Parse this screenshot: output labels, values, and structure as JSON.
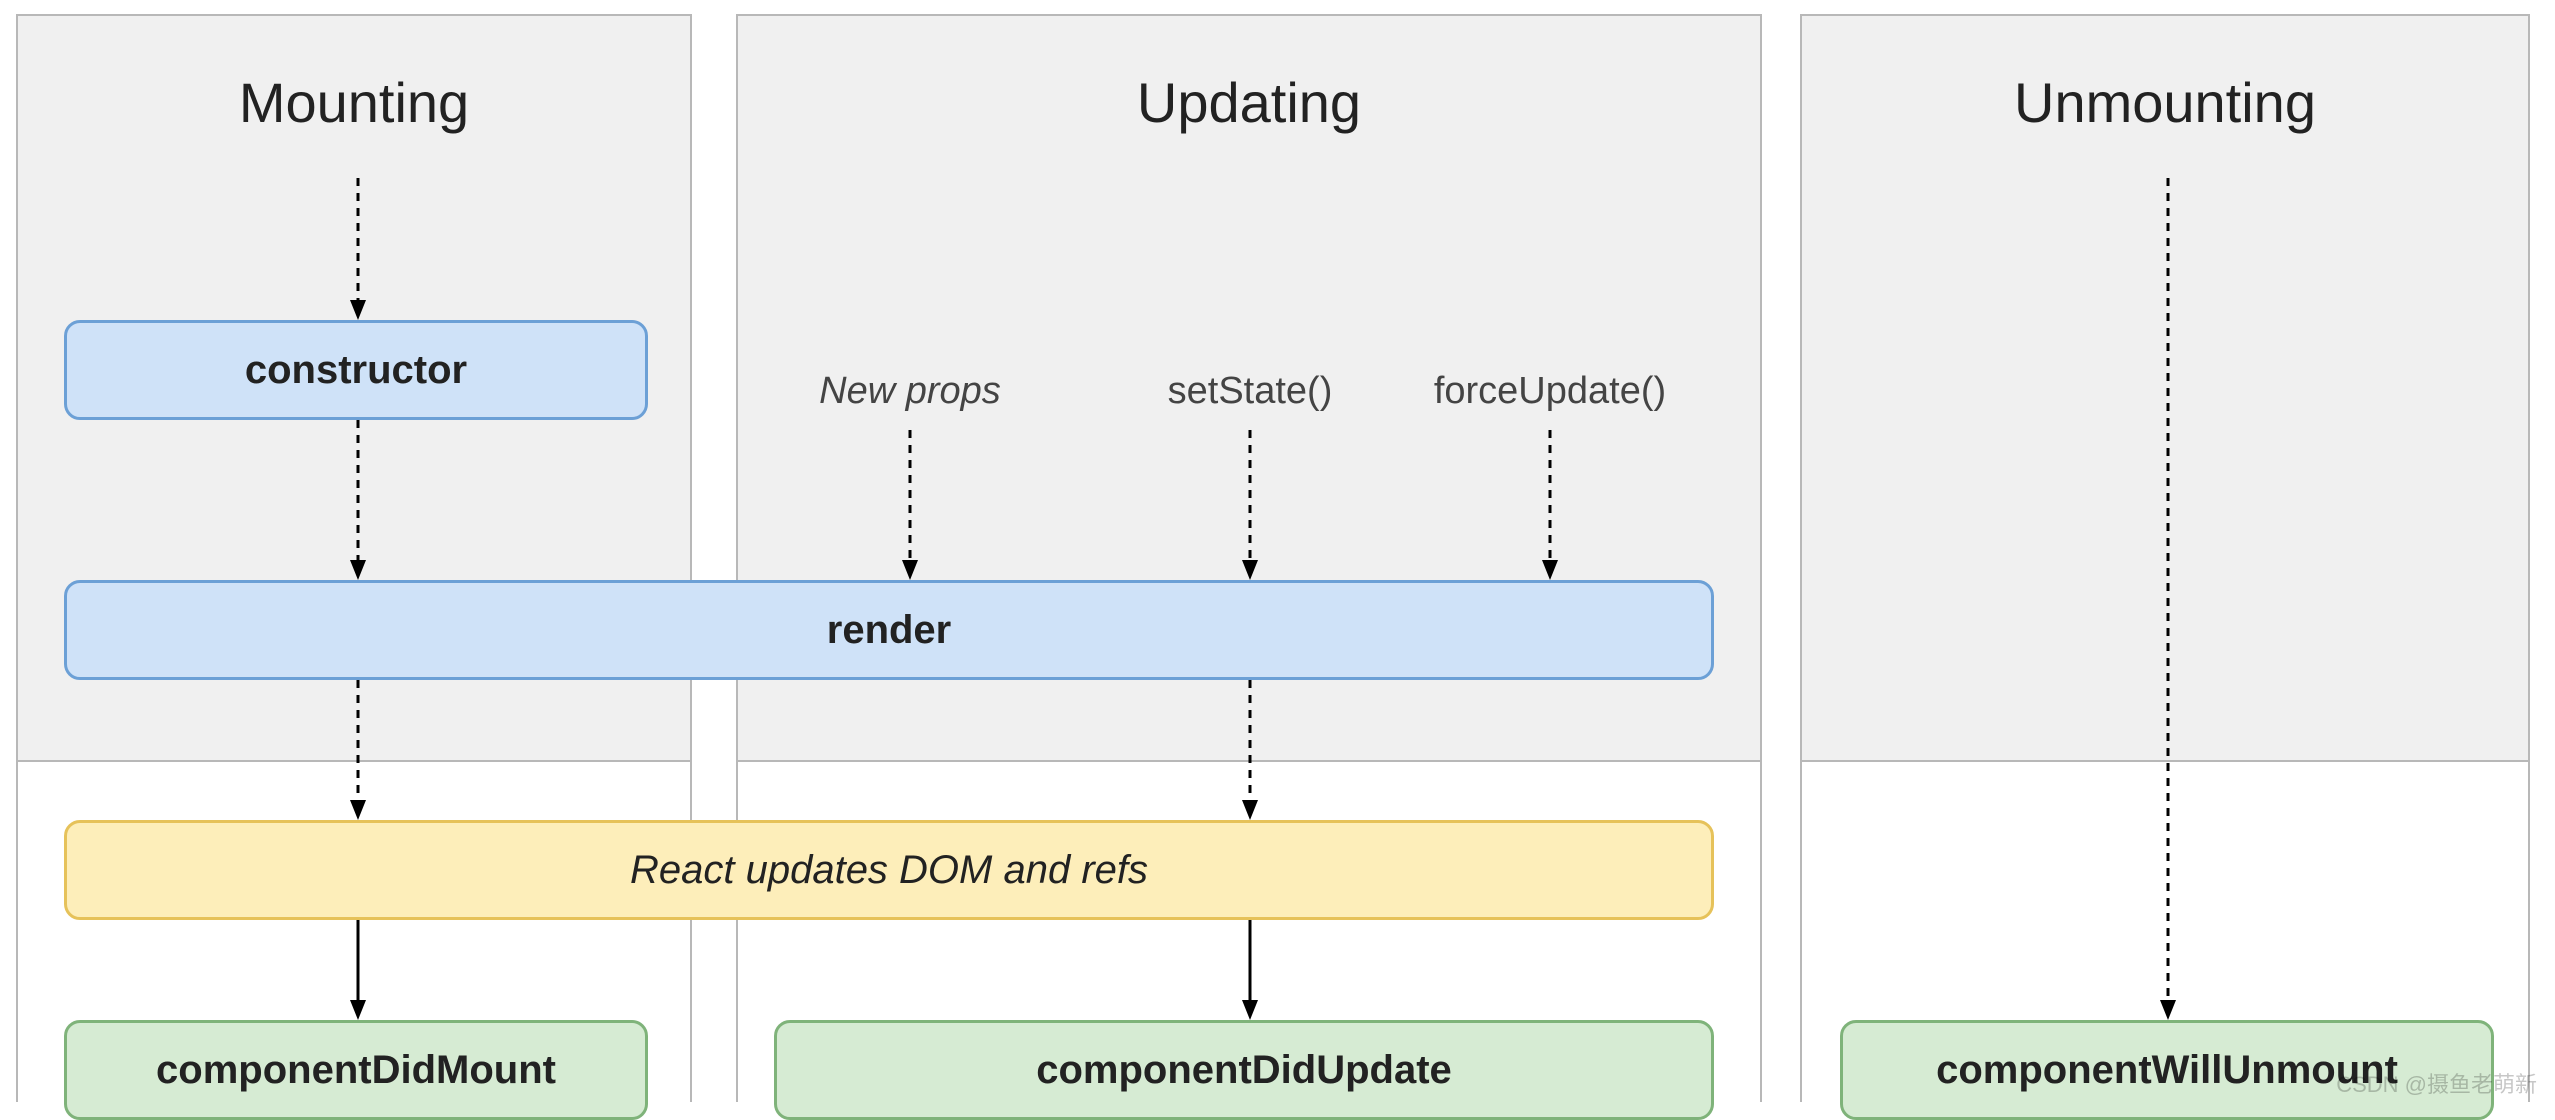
{
  "columns": {
    "mounting": {
      "title": "Mounting"
    },
    "updating": {
      "title": "Updating"
    },
    "unmounting": {
      "title": "Unmounting"
    }
  },
  "triggers": {
    "newProps": "New props",
    "setState": "setState()",
    "forceUpdate": "forceUpdate()"
  },
  "boxes": {
    "constructor": "constructor",
    "render": "render",
    "domRefs": "React updates DOM and refs",
    "componentDidMount": "componentDidMount",
    "componentDidUpdate": "componentDidUpdate",
    "componentWillUnmount": "componentWillUnmount"
  },
  "watermark": "CSDN @摄鱼老萌新",
  "colors": {
    "columnBg": "#f0f0f0",
    "columnBorder": "#b8b8b8",
    "blueFill": "#cfe2f8",
    "blueBorder": "#6ca0d6",
    "yellowFill": "#fdeeba",
    "yellowBorder": "#e6c25a",
    "greenFill": "#d6ebd3",
    "greenBorder": "#7fb37a"
  }
}
